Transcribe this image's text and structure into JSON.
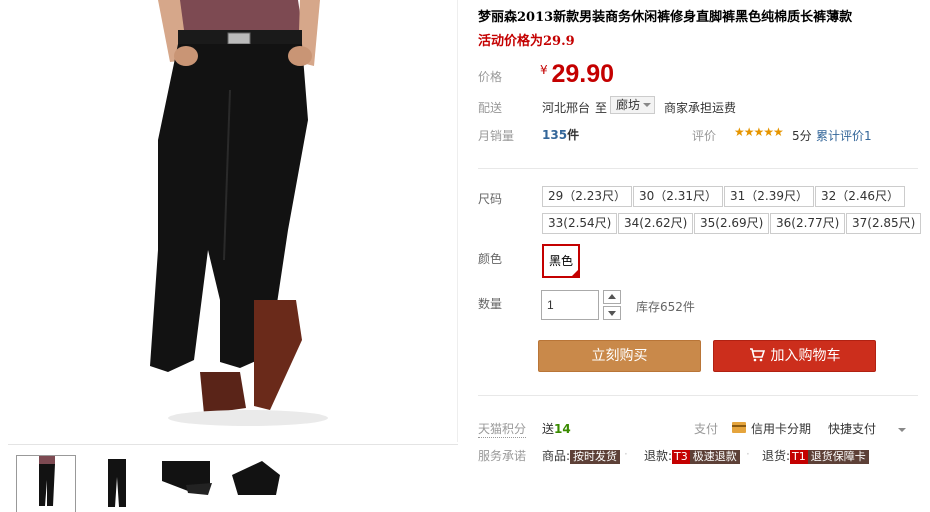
{
  "product": {
    "title": "梦丽森2013新款男装商务休闲裤修身直脚裤黑色纯棉质长裤薄款",
    "promo": "活动价格为29.9"
  },
  "price": {
    "label": "价格",
    "currency": "¥",
    "value": "29.90"
  },
  "delivery": {
    "label": "配送",
    "from": "河北邢台",
    "to_word": "至",
    "destination": "廊坊",
    "note": "商家承担运费"
  },
  "sales": {
    "label": "月销量",
    "count": "135",
    "unit": "件",
    "rating_label": "评价",
    "stars": "★★★★★",
    "score": "5分",
    "reviews": "累计评价1"
  },
  "sizes": {
    "label": "尺码",
    "options": [
      "29（2.23尺）",
      "30（2.31尺）",
      "31（2.39尺）",
      "32（2.46尺）",
      "33(2.54尺)",
      "34(2.62尺)",
      "35(2.69尺)",
      "36(2.77尺)",
      "37(2.85尺)"
    ]
  },
  "color": {
    "label": "颜色",
    "selected": "黑色"
  },
  "quantity": {
    "label": "数量",
    "value": "1",
    "stock": "库存652件"
  },
  "actions": {
    "buy_now": "立刻购买",
    "add_to_cart": "加入购物车"
  },
  "extras": {
    "points_label": "天猫积分",
    "points_prefix": "送",
    "points_value": "14",
    "pay_label": "支付",
    "pay_option1": "信用卡分期",
    "pay_option2": "快捷支付",
    "service_label": "服务承诺",
    "svc_goods_prefix": "商品:",
    "svc_goods_tag": "按时发货",
    "svc_refund_prefix": "退款:",
    "svc_refund_badge": "T3",
    "svc_refund_tag": "极速退款",
    "svc_return_prefix": "退货:",
    "svc_return_badge": "T1",
    "svc_return_tag": "退货保障卡"
  },
  "colors": {
    "price_red": "#c40000",
    "buy_button": "#c9894a",
    "cart_button": "#cc2e1c",
    "sales_blue": "#336699",
    "points_green": "#3a8b00"
  }
}
